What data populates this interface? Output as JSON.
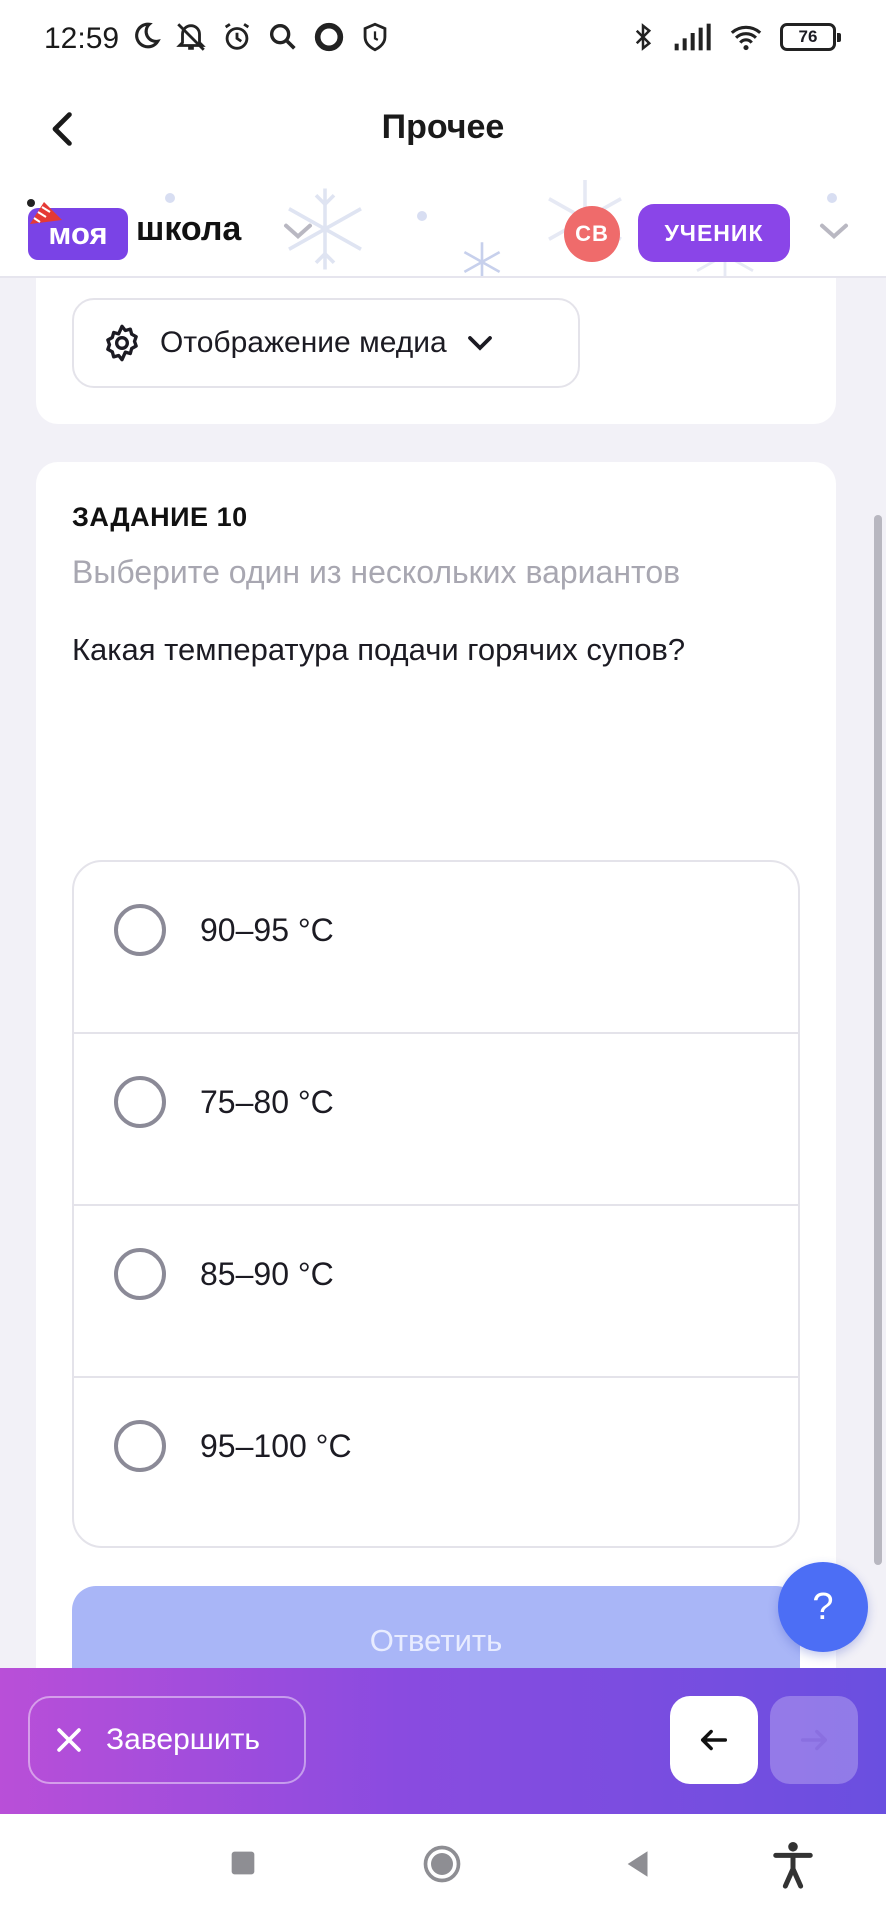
{
  "status_bar": {
    "time": "12:59",
    "battery": "76",
    "left_icons": [
      "moon-icon",
      "mute-icon",
      "alarm-icon",
      "search-icon",
      "circle-icon",
      "shield-icon"
    ],
    "right_icons": [
      "bluetooth-icon",
      "signal-icon",
      "wifi-icon",
      "battery-icon"
    ]
  },
  "app_bar": {
    "title": "Прочее"
  },
  "site_header": {
    "logo_badge": "моя",
    "logo_text": "школа",
    "avatar_initials": "СВ",
    "role": "УЧЕНИК"
  },
  "media_settings": {
    "label": "Отображение медиа"
  },
  "task": {
    "number": "ЗАДАНИЕ 10",
    "hint": "Выберите один из нескольких вариантов",
    "question": "Какая температура подачи горячих супов?",
    "options": [
      {
        "label": "90–95 °C",
        "selected": false
      },
      {
        "label": "75–80 °C",
        "selected": false
      },
      {
        "label": "85–90 °C",
        "selected": false
      },
      {
        "label": "95–100 °C",
        "selected": false
      }
    ],
    "submit_label": "Ответить"
  },
  "help_button": "?",
  "action_bar": {
    "finish_label": "Завершить"
  },
  "colors": {
    "brand_purple": "#7a43e6",
    "submit_disabled": "#a9b6f7",
    "help_blue": "#4c6ef5",
    "avatar_red": "#ef6b6b"
  }
}
